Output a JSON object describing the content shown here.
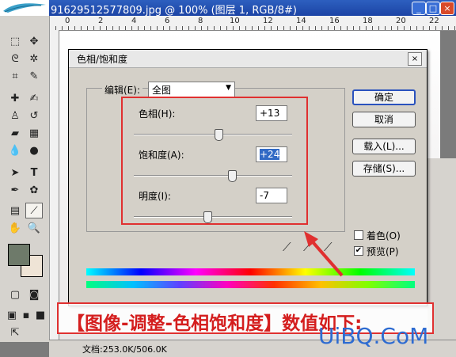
{
  "window": {
    "title": "91629512577809.jpg @ 100% (图层 1, RGB/8#)",
    "controls": [
      "_",
      "□",
      "×"
    ]
  },
  "ruler_top": {
    "ticks": [
      "0",
      "2",
      "4",
      "6",
      "8",
      "10",
      "12",
      "14",
      "16",
      "18",
      "20",
      "22"
    ]
  },
  "status_bar": {
    "doc_size": "文档:253.0K/506.0K"
  },
  "dialog": {
    "title": "色相/饱和度",
    "close": "×",
    "edit_label": "编辑(E):",
    "edit_value": "全图",
    "hue_label": "色相(H):",
    "hue_value": "+13",
    "hue_level": 13,
    "saturation_label": "饱和度(A):",
    "saturation_value": "+24",
    "saturation_level": 24,
    "lightness_label": "明度(I):",
    "lightness_value": "-7",
    "lightness_level": -7,
    "buttons": {
      "ok": "确定",
      "cancel": "取消",
      "load": "载入(L)...",
      "save": "存储(S)..."
    },
    "colorize_label": "着色(O)",
    "colorize_checked": false,
    "preview_label": "预览(P)",
    "preview_checked": true
  },
  "caption": "【图像-调整-色相饱和度】数值如下:",
  "watermark": "UiBQ.CoM",
  "colors": {
    "fg_swatch": "#6e7a6a",
    "bg_swatch": "#efe4d6",
    "annotation_red": "#e03030",
    "title_bar_blue": "#1c44a5"
  },
  "icons": [
    "feather-logo-icon",
    "marquee-icon",
    "move-icon",
    "lasso-icon",
    "magic-wand-icon",
    "crop-icon",
    "slice-icon",
    "healing-brush-icon",
    "brush-icon",
    "clone-stamp-icon",
    "history-brush-icon",
    "eraser-icon",
    "gradient-icon",
    "blur-icon",
    "dodge-icon",
    "path-select-icon",
    "type-icon",
    "pen-icon",
    "shape-icon",
    "notes-icon",
    "eyedropper-icon",
    "hand-icon",
    "zoom-icon"
  ]
}
